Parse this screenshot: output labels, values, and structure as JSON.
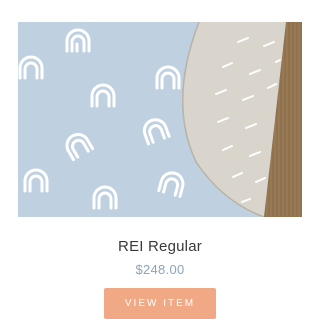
{
  "product": {
    "title": "REI Regular",
    "price": "$248.00",
    "button_label": "VIEW ITEM"
  },
  "colors": {
    "mat": "#bfd0e0",
    "mat_back": "#d9d4cc",
    "jute": "#9b7b57",
    "button": "#f1a885",
    "price": "#8aa5bd"
  }
}
